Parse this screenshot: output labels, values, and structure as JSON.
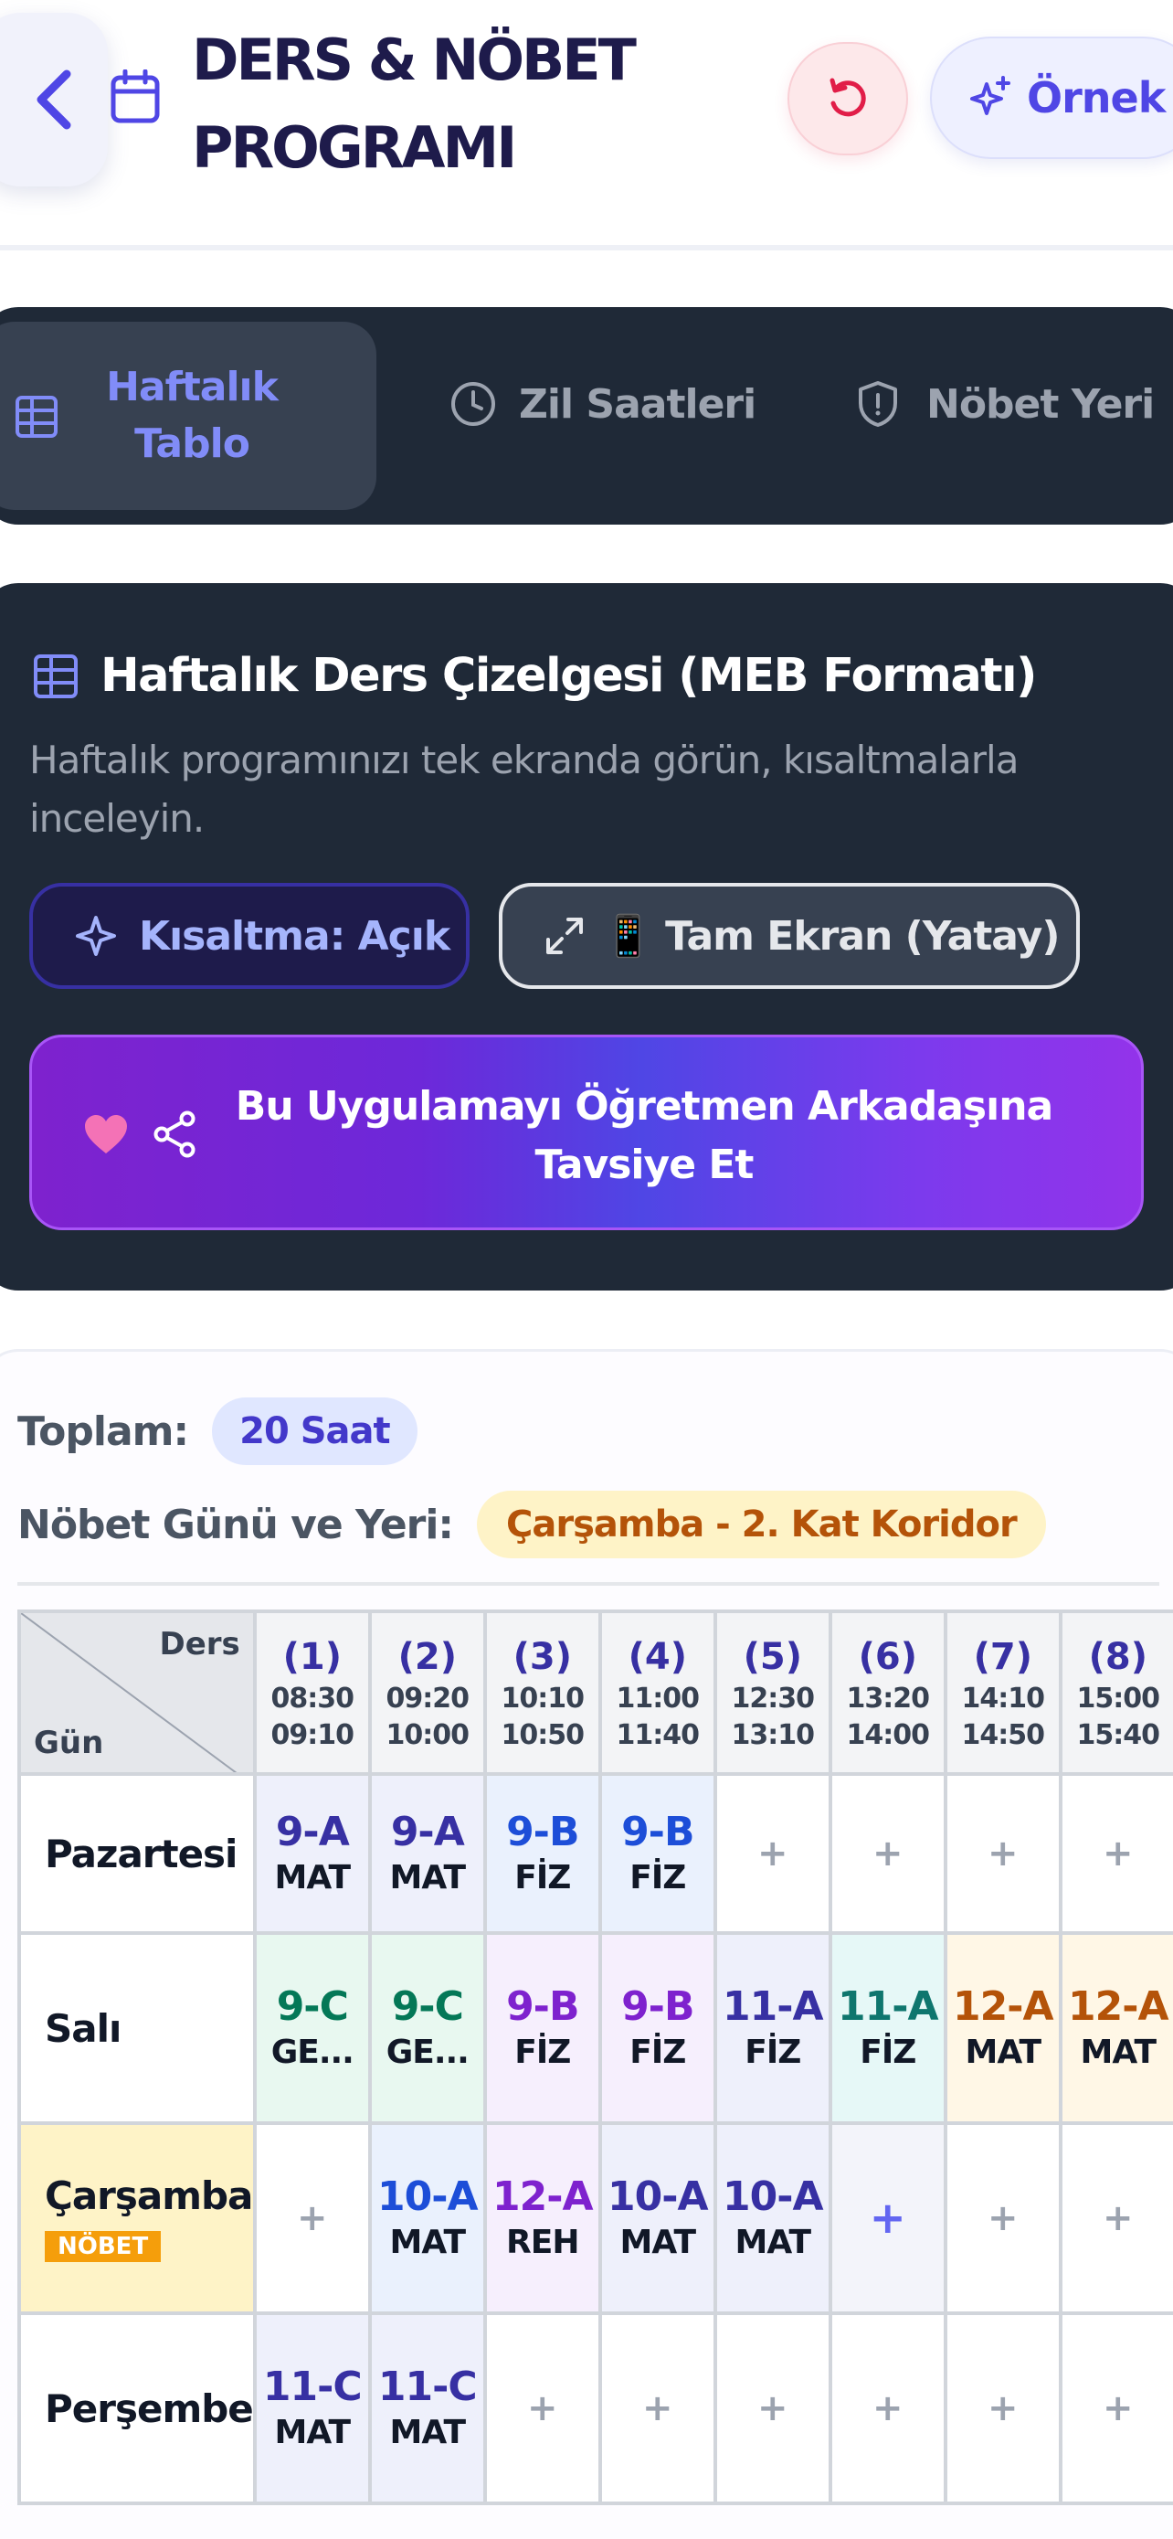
{
  "header": {
    "title": "DERS & NÖBET PROGRAMI",
    "example_label": "Örnek",
    "icons": [
      "chevron-left-icon",
      "calendar-icon",
      "reset-icon",
      "sparkle-icon"
    ],
    "colors": {
      "accent": "#4f46e5",
      "title": "#1e1b4b",
      "reset": "#e11d48"
    }
  },
  "tabs": [
    {
      "label": "Haftalık Tablo",
      "icon": "table-icon",
      "active": true
    },
    {
      "label": "Zil Saatleri",
      "icon": "clock-icon",
      "active": false
    },
    {
      "label": "Nöbet Yeri",
      "icon": "shield-icon",
      "active": false
    }
  ],
  "card": {
    "title": "Haftalık Ders Çizelgesi (MEB Formatı)",
    "subtitle": "Haftalık programınızı tek ekranda görün, kısaltmalarla inceleyin.",
    "abbr_button": "Kısaltma: Açık",
    "fullscreen_button": "📱 Tam Ekran (Yatay)",
    "recommend_button": "Bu Uygulamayı Öğretmen Arkadaşına Tavsiye Et"
  },
  "summary": {
    "total_label": "Toplam:",
    "total_value": "20 Saat",
    "duty_label": "Nöbet Günü ve Yeri:",
    "duty_value": "Çarşamba - 2. Kat Koridor"
  },
  "schedule": {
    "corner_top": "Ders",
    "corner_bottom": "Gün",
    "periods": [
      {
        "num": "(1)",
        "start": "08:30",
        "end": "09:10"
      },
      {
        "num": "(2)",
        "start": "09:20",
        "end": "10:00"
      },
      {
        "num": "(3)",
        "start": "10:10",
        "end": "10:50"
      },
      {
        "num": "(4)",
        "start": "11:00",
        "end": "11:40"
      },
      {
        "num": "(5)",
        "start": "12:30",
        "end": "13:10"
      },
      {
        "num": "(6)",
        "start": "13:20",
        "end": "14:00"
      },
      {
        "num": "(7)",
        "start": "14:10",
        "end": "14:50"
      },
      {
        "num": "(8)",
        "start": "15:00",
        "end": "15:40"
      }
    ],
    "duty_badge": "NÖBET",
    "empty_symbol": "+",
    "rows": [
      {
        "day": "Pazartesi",
        "duty": false,
        "cells": [
          {
            "cls": "9-A",
            "subj": "MAT",
            "color": "#3730a3",
            "bg": "#eef0fb"
          },
          {
            "cls": "9-A",
            "subj": "MAT",
            "color": "#3730a3",
            "bg": "#eef0fb"
          },
          {
            "cls": "9-B",
            "subj": "FİZ",
            "color": "#1d4ed8",
            "bg": "#eaf1fd"
          },
          {
            "cls": "9-B",
            "subj": "FİZ",
            "color": "#1d4ed8",
            "bg": "#eaf1fd"
          },
          null,
          null,
          null,
          null
        ]
      },
      {
        "day": "Salı",
        "duty": false,
        "cells": [
          {
            "cls": "9-C",
            "subj": "GE...",
            "color": "#047857",
            "bg": "#e8f8f0"
          },
          {
            "cls": "9-C",
            "subj": "GE...",
            "color": "#047857",
            "bg": "#e8f8f0"
          },
          {
            "cls": "9-B",
            "subj": "FİZ",
            "color": "#7e22ce",
            "bg": "#f6effd"
          },
          {
            "cls": "9-B",
            "subj": "FİZ",
            "color": "#7e22ce",
            "bg": "#f6effd"
          },
          {
            "cls": "11-A",
            "subj": "FİZ",
            "color": "#3730a3",
            "bg": "#eef0fb"
          },
          {
            "cls": "11-A",
            "subj": "FİZ",
            "color": "#0f766e",
            "bg": "#e6f8f7"
          },
          {
            "cls": "12-A",
            "subj": "MAT",
            "color": "#b45309",
            "bg": "#fff7e6"
          },
          {
            "cls": "12-A",
            "subj": "MAT",
            "color": "#b45309",
            "bg": "#fff7e6"
          }
        ]
      },
      {
        "day": "Çarşamba",
        "duty": true,
        "cells": [
          null,
          {
            "cls": "10-A",
            "subj": "MAT",
            "color": "#1d4ed8",
            "bg": "#eaf1fd"
          },
          {
            "cls": "12-A",
            "subj": "REH",
            "color": "#7e22ce",
            "bg": "#f6effd"
          },
          {
            "cls": "10-A",
            "subj": "MAT",
            "color": "#3730a3",
            "bg": "#eef0fb"
          },
          {
            "cls": "10-A",
            "subj": "MAT",
            "color": "#3730a3",
            "bg": "#eef0fb"
          },
          "strong",
          null,
          null
        ]
      },
      {
        "day": "Perşembe",
        "duty": false,
        "cells": [
          {
            "cls": "11-C",
            "subj": "MAT",
            "color": "#3730a3",
            "bg": "#eef0fb"
          },
          {
            "cls": "11-C",
            "subj": "MAT",
            "color": "#3730a3",
            "bg": "#eef0fb"
          },
          null,
          null,
          null,
          null,
          null,
          null
        ]
      }
    ]
  }
}
